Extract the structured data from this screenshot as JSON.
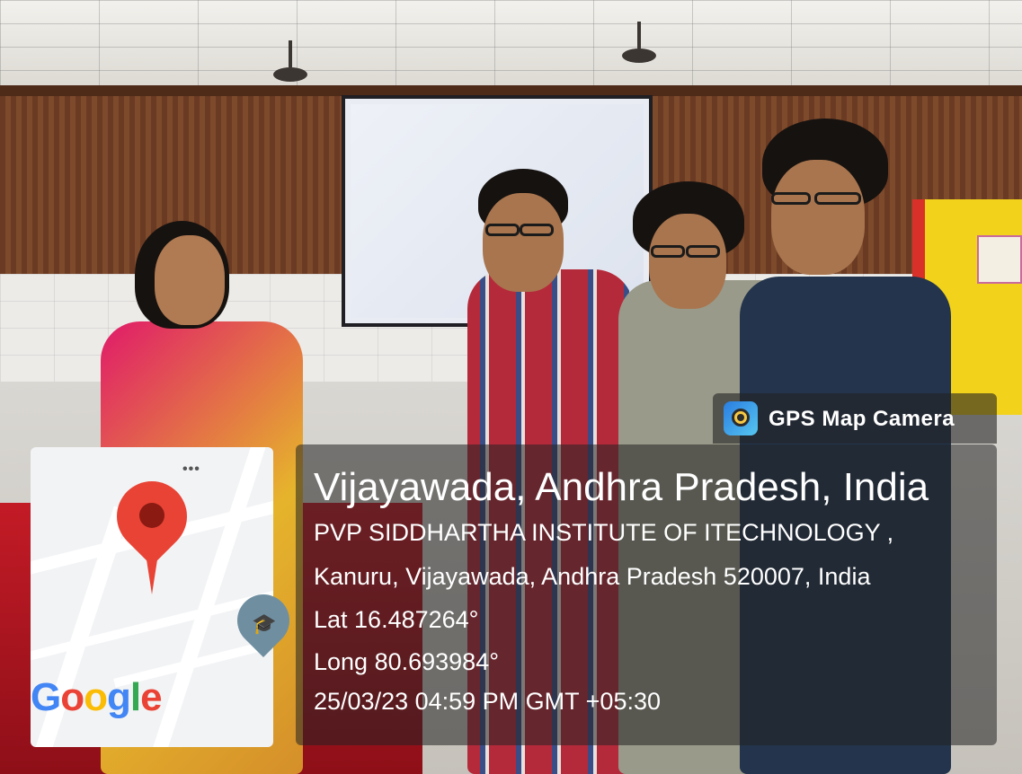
{
  "overlay": {
    "app_name": "GPS Map Camera",
    "location_title": "Vijayawada, Andhra Pradesh, India",
    "address_line1": "PVP SIDDHARTHA INSTITUTE OF ITECHNOLOGY ,",
    "address_line2": "Kanuru, Vijayawada, Andhra Pradesh 520007, India",
    "latitude": "Lat 16.487264°",
    "longitude": "Long 80.693984°",
    "timestamp": "25/03/23 04:59 PM GMT +05:30"
  },
  "map": {
    "menu_dots": "•••",
    "logo_letters": [
      "G",
      "o",
      "o",
      "g",
      "l",
      "e"
    ],
    "logo_colors": [
      "#4285F4",
      "#EA4335",
      "#FBBC05",
      "#4285F4",
      "#34A853",
      "#EA4335"
    ],
    "pin_color": "#E84335",
    "school_icon": "🎓"
  }
}
